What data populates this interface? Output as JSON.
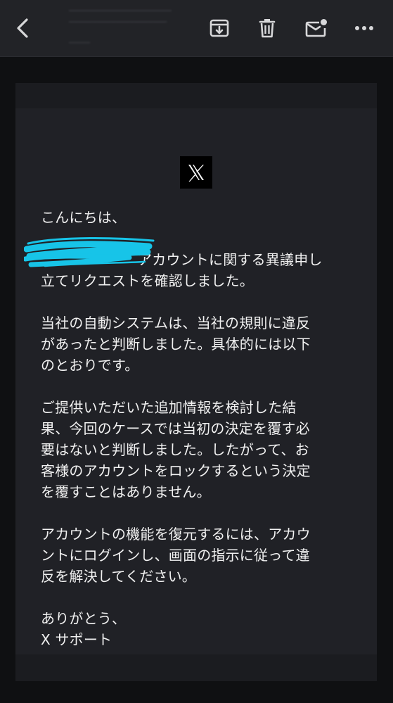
{
  "header": {
    "back_icon": "chevron-left-icon",
    "actions": [
      {
        "name": "archive",
        "icon": "archive-download-icon"
      },
      {
        "name": "delete",
        "icon": "trash-icon"
      },
      {
        "name": "mark-unread",
        "icon": "mail-unread-icon"
      },
      {
        "name": "more",
        "icon": "more-dots-icon"
      }
    ]
  },
  "email": {
    "logo_text": "X",
    "greeting": "こんにちは、",
    "p1": "アカウントに関する異議申し\n立てリクエストを確認しました。",
    "p2": "当社の自動システムは、当社の規則に違反\nがあったと判断しました。具体的には以下\nのとおりです。",
    "p3": "ご提供いただいた追加情報を検討した結\n果、今回のケースでは当初の決定を覆す必\n要はないと判断しました。したがって、お\n客様のアカウントをロックするという決定\nを覆すことはありません。",
    "p4": "アカウントの機能を復元するには、アカウ\nントにログインし、画面の指示に従って違\n反を解決してください。",
    "signoff": "ありがとう、\nX サポート"
  },
  "colors": {
    "header_bg": "#222327",
    "page_bg": "#0f1012",
    "card_bg": "#202126",
    "text": "#f1f1f1",
    "redaction": "#17c4e8"
  }
}
